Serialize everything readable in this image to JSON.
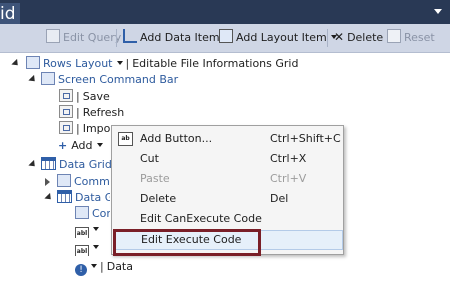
{
  "window": {
    "title_fragment": "id"
  },
  "toolbar": {
    "edit_query": "Edit Query",
    "add_data_item": "Add Data Item...",
    "add_layout_item": "Add Layout Item",
    "delete": "Delete",
    "reset": "Reset"
  },
  "tree": {
    "rows_layout": "Rows Layout",
    "rows_layout_desc": "Editable File Informations Grid",
    "screen_command_bar": "Screen Command Bar",
    "save": "Save",
    "refresh": "Refresh",
    "import": "Import File",
    "add": "Add",
    "data_grid": "Data Grid",
    "command": "Command Bar",
    "data_grid_row": "Data Grid Row",
    "com": "Com",
    "data": "Data"
  },
  "context_menu": {
    "items": [
      {
        "label": "Add Button...",
        "shortcut": "Ctrl+Shift+C",
        "enabled": true
      },
      {
        "label": "Cut",
        "shortcut": "Ctrl+X",
        "enabled": true
      },
      {
        "label": "Paste",
        "shortcut": "Ctrl+V",
        "enabled": false
      },
      {
        "label": "Delete",
        "shortcut": "Del",
        "enabled": true
      },
      {
        "label": "Edit CanExecute Code",
        "shortcut": "",
        "enabled": true
      },
      {
        "label": "Edit Execute Code",
        "shortcut": "",
        "enabled": true,
        "highlighted": true
      }
    ]
  },
  "colors": {
    "topbar": "#293955",
    "toolbar": "#cfd6e5",
    "highlight_outline": "#7a1f28",
    "link_blue": "#2e5b9e"
  }
}
